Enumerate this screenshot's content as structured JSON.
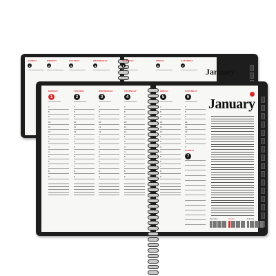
{
  "back_planner": {
    "month": "January",
    "days": [
      {
        "name": "SUNDAY",
        "num": "1"
      },
      {
        "name": "MONDAY",
        "num": "2"
      },
      {
        "name": "TUESDAY",
        "num": "3"
      },
      {
        "name": "WEDNESDAY",
        "num": "4"
      },
      {
        "name": "THURSDAY",
        "num": "5"
      },
      {
        "name": "FRIDAY",
        "num": "6"
      },
      {
        "name": "SATURDAY",
        "num": "7"
      }
    ],
    "hours": [
      "8",
      "9",
      "10",
      "11",
      "12",
      "1",
      "2",
      "3",
      "4",
      "5",
      "6",
      "7",
      "8"
    ],
    "left_hours": [
      "7/8",
      "20",
      "26",
      "27",
      "28"
    ]
  },
  "front_planner": {
    "month": "January",
    "left_days": [
      {
        "name": "MONDAY",
        "num": "1"
      },
      {
        "name": "TUESDAY",
        "num": "2"
      },
      {
        "name": "WEDNESDAY",
        "num": "3"
      },
      {
        "name": "THURSDAY",
        "num": "4"
      }
    ],
    "right_days": [
      {
        "name": "FRIDAY",
        "num": "5"
      },
      {
        "name": "SATURDAY",
        "num": "6"
      },
      {
        "name": "SUNDAY",
        "num": "7"
      }
    ],
    "hours": [
      "7",
      "8",
      "9",
      "10",
      "11",
      "12",
      "1",
      "2",
      "3",
      "4",
      "5",
      "6",
      "7",
      "8",
      "9"
    ],
    "mini_calendars": [
      "December",
      "January",
      "February"
    ]
  },
  "colors": {
    "accent": "#d62a2a",
    "cover": "#1d1d1d",
    "page": "#f7f7f5"
  }
}
